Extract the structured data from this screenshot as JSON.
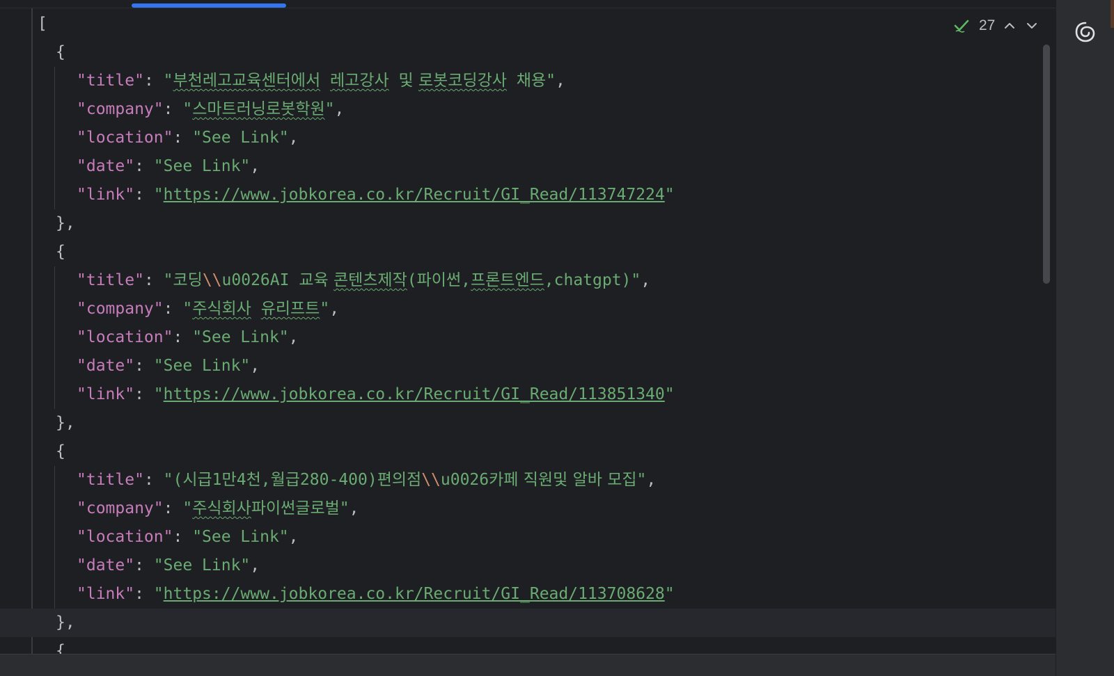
{
  "tab": {
    "active": true
  },
  "inspection": {
    "count": "27"
  },
  "colors": {
    "background": "#1e1f22",
    "key": "#c77dbb",
    "string": "#6aab73",
    "escape": "#cf8e6d",
    "accent": "#3574f0"
  },
  "icons": {
    "inspection": "double-check-icon",
    "previous": "chevron-up-icon",
    "next": "chevron-down-icon",
    "assistant": "ai-assistant-spiral-icon"
  },
  "editor": {
    "open_bracket": "[",
    "records": [
      {
        "title": "부천레고교육센터에서 레고강사 및 로봇코딩강사 채용",
        "company": "스마트러닝로봇학원",
        "location": "See Link",
        "date": "See Link",
        "link": "https://www.jobkorea.co.kr/Recruit/GI_Read/113747224"
      },
      {
        "title": "코딩\\\\u0026AI 교육 콘텐츠제작(파이썬,프론트엔드,chatgpt)",
        "company": "주식회사 유리프트",
        "location": "See Link",
        "date": "See Link",
        "link": "https://www.jobkorea.co.kr/Recruit/GI_Read/113851340"
      },
      {
        "title": "(시급1만4천,월급280-400)편의점\\\\u0026카페 직원및 알바 모집",
        "company": "주식회사파이썬글로벌",
        "location": "See Link",
        "date": "See Link",
        "link": "https://www.jobkorea.co.kr/Recruit/GI_Read/113708628"
      }
    ],
    "trailing_open_brace": "{"
  }
}
